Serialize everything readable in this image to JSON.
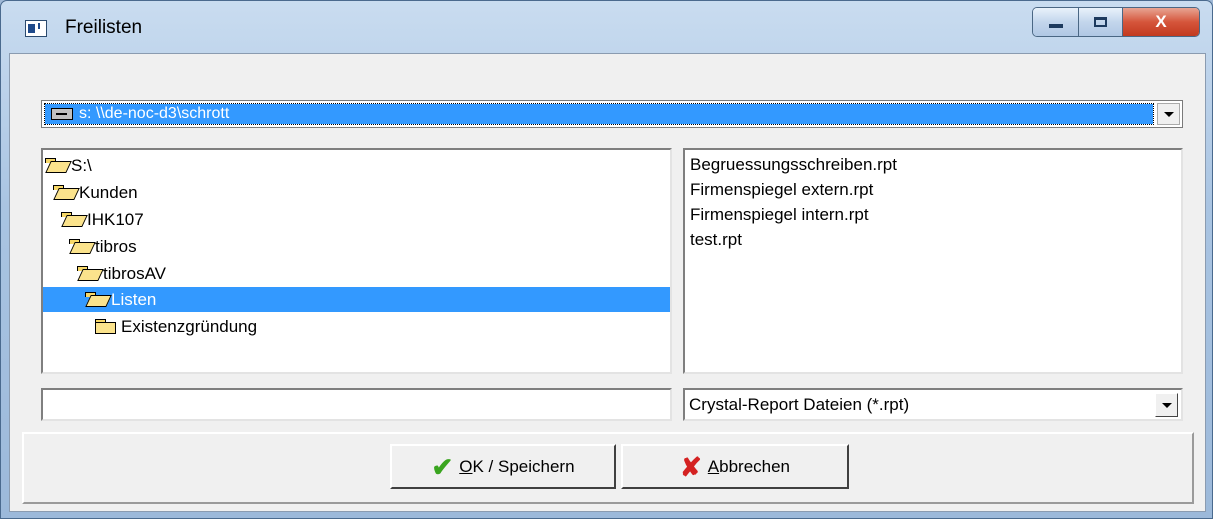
{
  "window": {
    "title": "Freilisten",
    "close_label": "X"
  },
  "drive": {
    "selected": "s: \\\\de-noc-d3\\schrott",
    "icon": "network-drive-icon"
  },
  "directories": [
    {
      "label": "S:\\",
      "indent": 0,
      "state": "open"
    },
    {
      "label": "Kunden",
      "indent": 1,
      "state": "open"
    },
    {
      "label": "IHK107",
      "indent": 2,
      "state": "open"
    },
    {
      "label": "tibros",
      "indent": 3,
      "state": "open"
    },
    {
      "label": "tibrosAV",
      "indent": 4,
      "state": "open"
    },
    {
      "label": "Listen",
      "indent": 5,
      "state": "open",
      "selected": true
    },
    {
      "label": "Existenzgründung",
      "indent": 6,
      "state": "closed"
    }
  ],
  "files": [
    "Begruessungsschreiben.rpt",
    "Firmenspiegel extern.rpt",
    "Firmenspiegel intern.rpt",
    "test.rpt"
  ],
  "filename_input": {
    "value": ""
  },
  "file_filter": {
    "selected": "Crystal-Report Dateien (*.rpt)"
  },
  "buttons": {
    "ok": {
      "accel": "O",
      "rest": "K / Speichern",
      "icon": "checkmark-icon",
      "color": "#3aa51f"
    },
    "cancel": {
      "accel": "A",
      "rest": "bbrechen",
      "icon": "cross-icon",
      "color": "#d42121"
    }
  },
  "colors": {
    "selection": "#3399ff",
    "dialog_bg": "#f0f0f0",
    "close_button": "#c23a1f"
  }
}
